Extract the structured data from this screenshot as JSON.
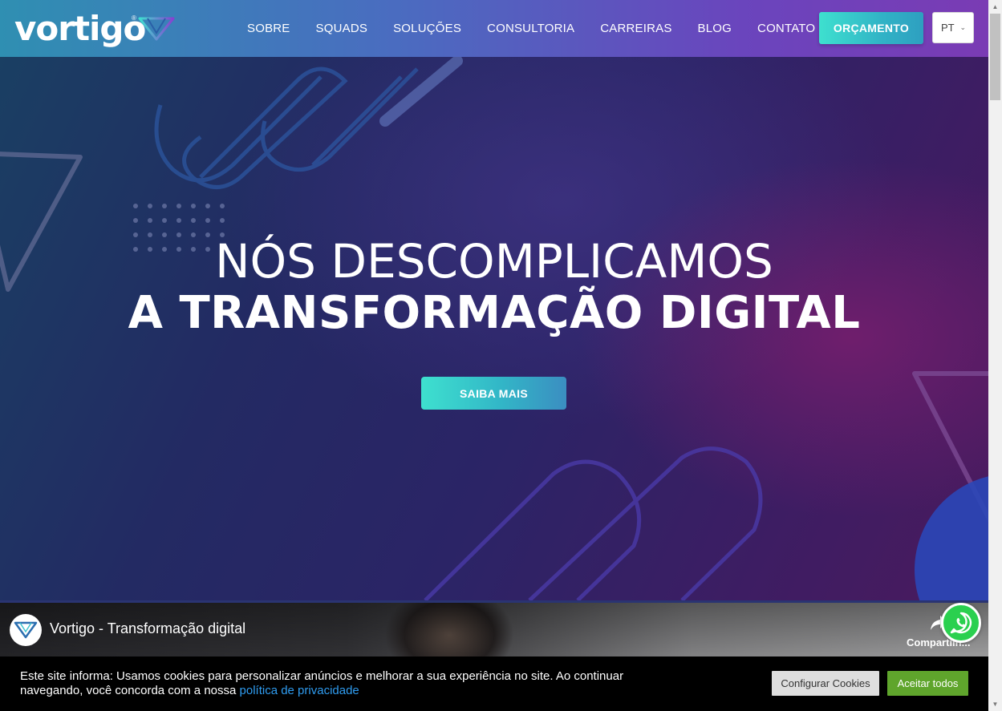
{
  "header": {
    "logo_text": "vortigo",
    "logo_registered": "®",
    "nav": [
      "SOBRE",
      "SQUADS",
      "SOLUÇÕES",
      "CONSULTORIA",
      "CARREIRAS",
      "BLOG",
      "CONTATO"
    ],
    "cta_label": "ORÇAMENTO",
    "language": "PT",
    "language_chevron": "⌄"
  },
  "hero": {
    "title_line1": "NÓS DESCOMPLICAMOS",
    "title_line2": "A TRANSFORMAÇÃO DIGITAL",
    "button_label": "SAIBA MAIS"
  },
  "video": {
    "title": "Vortigo - Transformação digital",
    "share_label": "Compartilh..."
  },
  "cookie": {
    "text": "Este site informa: Usamos cookies para personalizar anúncios e melhorar a sua experiência no site. Ao continuar navegando, você concorda com a nossa ",
    "link_text": "política de privacidade",
    "configure_label": "Configurar Cookies",
    "accept_label": "Aceitar todos"
  },
  "colors": {
    "header_start": "#2f8fb2",
    "header_end": "#7a3bb4",
    "accent_cyan": "#3ee0cf",
    "accept_green": "#5fa52c",
    "whatsapp_green": "#2ad04f",
    "link_blue": "#2f9cf0"
  },
  "icons": {
    "logo_mark": "vortigo-v-icon",
    "whatsapp": "whatsapp-icon",
    "share": "share-arrow-icon"
  }
}
